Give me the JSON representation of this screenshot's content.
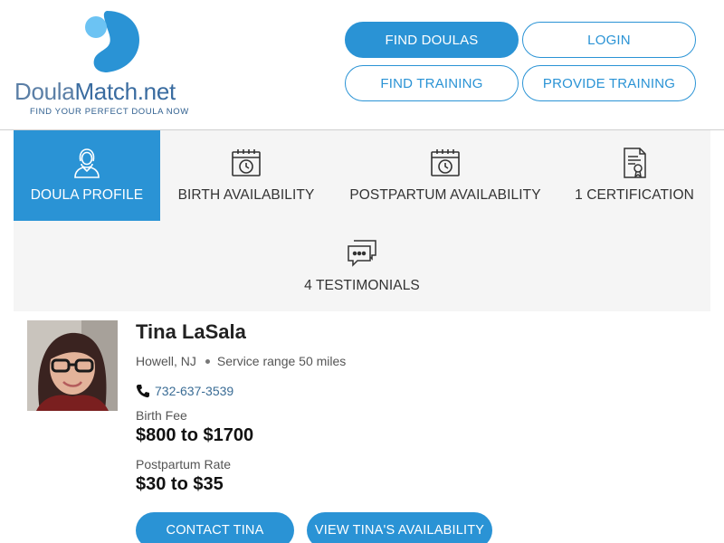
{
  "brand": {
    "name_part1": "Doula",
    "name_part2": "Match.net",
    "tagline": "FIND YOUR PERFECT DOULA NOW",
    "colors": {
      "primary": "#2a93d5",
      "logo_dark": "#3a6ca0",
      "logo_light": "#5ab8ef"
    }
  },
  "header": {
    "buttons": [
      {
        "label": "FIND DOULAS",
        "style": "solid"
      },
      {
        "label": "LOGIN",
        "style": "outline"
      },
      {
        "label": "FIND TRAINING",
        "style": "outline"
      },
      {
        "label": "PROVIDE TRAINING",
        "style": "outline"
      }
    ]
  },
  "tabs": [
    {
      "label": "DOULA PROFILE",
      "icon": "doula-person-icon",
      "active": true
    },
    {
      "label": "BIRTH AVAILABILITY",
      "icon": "calendar-clock-icon",
      "active": false
    },
    {
      "label": "POSTPARTUM AVAILABILITY",
      "icon": "calendar-clock-icon",
      "active": false
    },
    {
      "label": "1 CERTIFICATION",
      "icon": "certificate-icon",
      "active": false
    },
    {
      "label": "4 TESTIMONIALS",
      "icon": "chat-bubbles-icon",
      "active": false
    }
  ],
  "profile": {
    "name": "Tina LaSala",
    "location": "Howell, NJ",
    "service_range": "Service range 50 miles",
    "phone": "732-637-3539",
    "birth_fee_label": "Birth Fee",
    "birth_fee_value": "$800 to $1700",
    "postpartum_label": "Postpartum Rate",
    "postpartum_value": "$30 to $35"
  },
  "actions": {
    "contact_label": "CONTACT TINA",
    "availability_label": "VIEW TINA'S AVAILABILITY"
  }
}
